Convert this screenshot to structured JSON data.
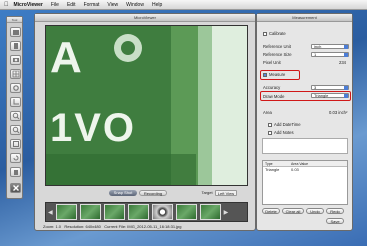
{
  "menubar": {
    "app_name": "MicroViewer",
    "items": [
      "File",
      "Edit",
      "Format",
      "View",
      "Window",
      "Help"
    ]
  },
  "tool_panel": {
    "title": "Tool"
  },
  "main_window": {
    "title": "MicroViewer",
    "controls": {
      "snap_label": "Snap Shot",
      "record_label": "Recording",
      "target_label": "Target",
      "target_value": "Left View"
    },
    "status": {
      "zoom": "Zoom: 1.0",
      "resolution": "Resolution: 640x480",
      "current_file": "Current File: IMG_2012-05-11_16:18:31.jpg"
    }
  },
  "viewer_text": {
    "line1": "A",
    "line2": "1VO"
  },
  "measure_window": {
    "title": "Measurement",
    "calibrate_label": "Calibrate",
    "reference_unit_label": "Reference Unit",
    "reference_unit_value": "inch",
    "reference_size_label": "Reference Size",
    "reference_size_value": "1",
    "pixel_unit_label": "Pixel Unit",
    "pixel_unit_value": "234",
    "measure_label": "Measure",
    "accuracy_label": "Accuracy",
    "accuracy_value": "3",
    "draw_mode_label": "Draw Mode",
    "draw_mode_value": "Triangle",
    "area_label": "Area",
    "area_value": "0.03 inch²",
    "add_datetime_label": "Add DateTime",
    "add_notes_label": "Add Notes",
    "table": {
      "columns": [
        "Type",
        "Area Value"
      ],
      "rows": [
        [
          "Triangle",
          "0.03"
        ]
      ]
    },
    "buttons": {
      "delete": "Delete",
      "clear_all": "Clear all",
      "undo": "Undo",
      "redo": "Redo",
      "save": "Save"
    }
  },
  "colors": {
    "highlight": "#d01818",
    "accent": "#4d7ed6"
  }
}
